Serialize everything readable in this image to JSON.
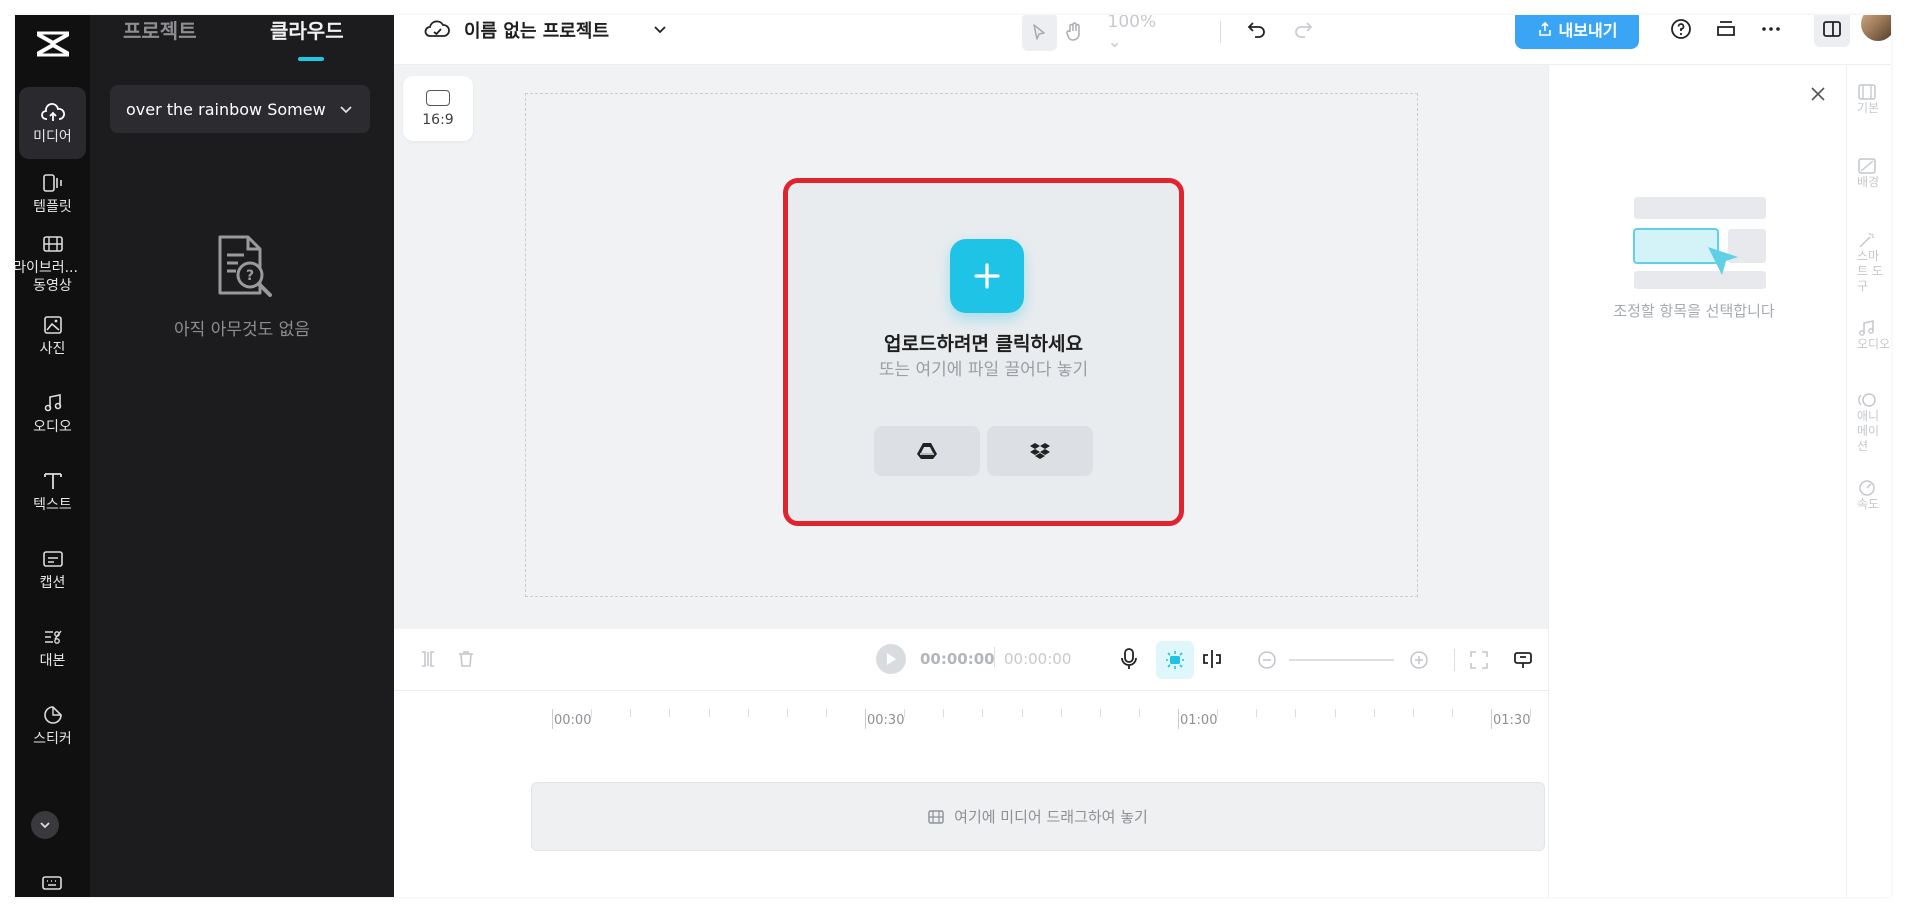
{
  "rail": {
    "items": [
      {
        "label": "미디어",
        "icon": "cloud-upload-icon"
      },
      {
        "label": "템플릿",
        "icon": "template-icon"
      },
      {
        "label": "라이브러리 동영상",
        "line1": "라이브러...",
        "line2": "동영상",
        "icon": "film-icon"
      },
      {
        "label": "사진",
        "icon": "image-icon"
      },
      {
        "label": "오디오",
        "icon": "music-icon"
      },
      {
        "label": "텍스트",
        "icon": "text-icon"
      },
      {
        "label": "캡션",
        "icon": "caption-icon"
      },
      {
        "label": "대본",
        "icon": "script-icon"
      },
      {
        "label": "스티커",
        "icon": "sticker-icon"
      }
    ]
  },
  "panel": {
    "tabs": [
      "프로젝트",
      "클라우드"
    ],
    "active_tab": "클라우드",
    "folder": "over the rainbow Somew",
    "empty_text": "아직 아무것도 없음"
  },
  "topbar": {
    "title": "이름 없는 프로젝트",
    "zoom": "100%",
    "export_label": "내보내기"
  },
  "canvas": {
    "ratio": "16:9",
    "upload_title": "업로드하려면 클릭하세요",
    "upload_subtitle": "또는 여기에 파일 끌어다 놓기",
    "highlight_color": "#e0242f",
    "accent_color": "#1fc3e6"
  },
  "timeline": {
    "current_time": "00:00:00",
    "total_time": "00:00:00",
    "ruler": [
      "00:00",
      "00:30",
      "01:00",
      "01:30"
    ],
    "drop_text": "여기에 미디어 드래그하여 놓기"
  },
  "properties": {
    "empty_text": "조정할 항목을 선택합니다"
  },
  "right_rail": {
    "items": [
      {
        "label": "기본"
      },
      {
        "label": "배경"
      },
      {
        "label": "스마트 도구"
      },
      {
        "label": "오디오"
      },
      {
        "label": "애니메이션"
      },
      {
        "label": "속도"
      }
    ]
  }
}
